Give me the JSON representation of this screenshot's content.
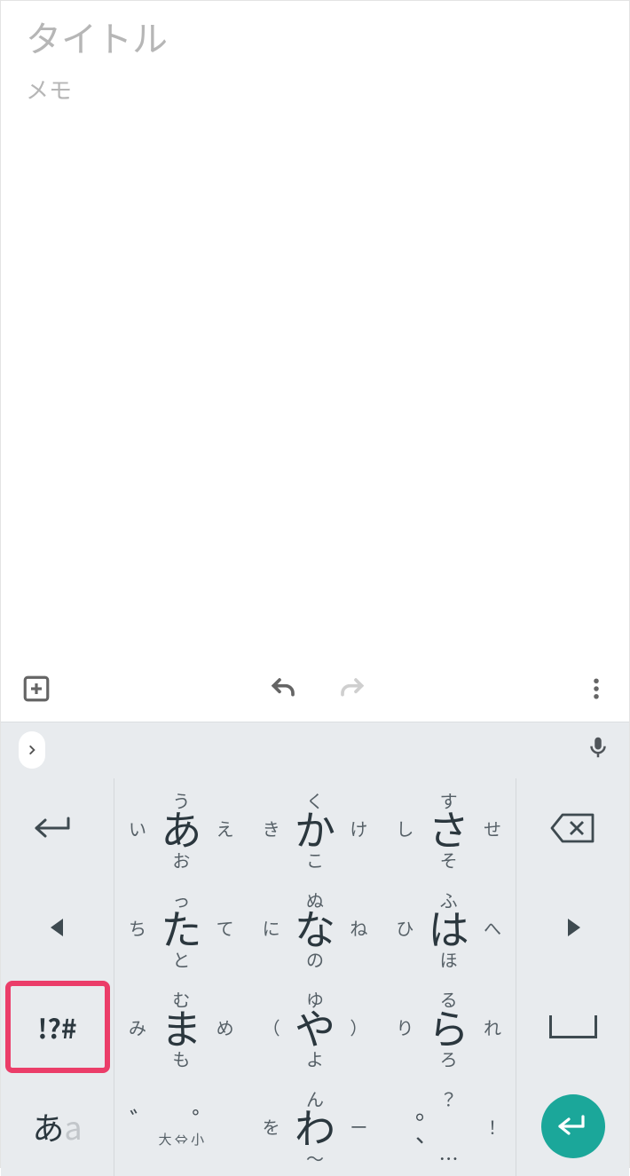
{
  "editor": {
    "title_placeholder": "タイトル",
    "body_placeholder": "メモ"
  },
  "suggestion_bar": {
    "expand_icon": "chevron-right",
    "mic_icon": "mic"
  },
  "toolbar": {
    "add_icon": "plus-box",
    "undo_icon": "undo",
    "redo_icon": "redo",
    "more_icon": "more-vert"
  },
  "keyboard": {
    "side_left": {
      "r1": "cursor-left-long",
      "r2": "triangle-left",
      "r3_symbols": "!?#",
      "r4_mode_active": "あ",
      "r4_mode_inactive": "a"
    },
    "side_right": {
      "r1": "backspace",
      "r2": "triangle-right",
      "r3": "space",
      "r4": "enter"
    },
    "grid": [
      [
        {
          "c": "あ",
          "u": "う",
          "d": "お",
          "l": "い",
          "r": "え"
        },
        {
          "c": "か",
          "u": "く",
          "d": "こ",
          "l": "き",
          "r": "け"
        },
        {
          "c": "さ",
          "u": "す",
          "d": "そ",
          "l": "し",
          "r": "せ"
        }
      ],
      [
        {
          "c": "た",
          "u": "っ",
          "d": "と",
          "l": "ち",
          "r": "て"
        },
        {
          "c": "な",
          "u": "ぬ",
          "d": "の",
          "l": "に",
          "r": "ね"
        },
        {
          "c": "は",
          "u": "ふ",
          "d": "ほ",
          "l": "ひ",
          "r": "へ"
        }
      ],
      [
        {
          "c": "ま",
          "u": "む",
          "d": "も",
          "l": "み",
          "r": "め"
        },
        {
          "c": "や",
          "u": "ゆ",
          "d": "よ",
          "l": "（",
          "r": "）"
        },
        {
          "c": "ら",
          "u": "る",
          "d": "ろ",
          "l": "り",
          "r": "れ"
        }
      ],
      [
        {
          "type": "dakuten",
          "top": "゛  ゜",
          "bot": "大 ⇔ 小"
        },
        {
          "c": "わ",
          "u": "ん",
          "d": "〜",
          "l": "を",
          "r": "ー"
        },
        {
          "type": "punct",
          "u": "？",
          "r": "！",
          "main": "。  、",
          "sub": "…"
        }
      ]
    ]
  }
}
